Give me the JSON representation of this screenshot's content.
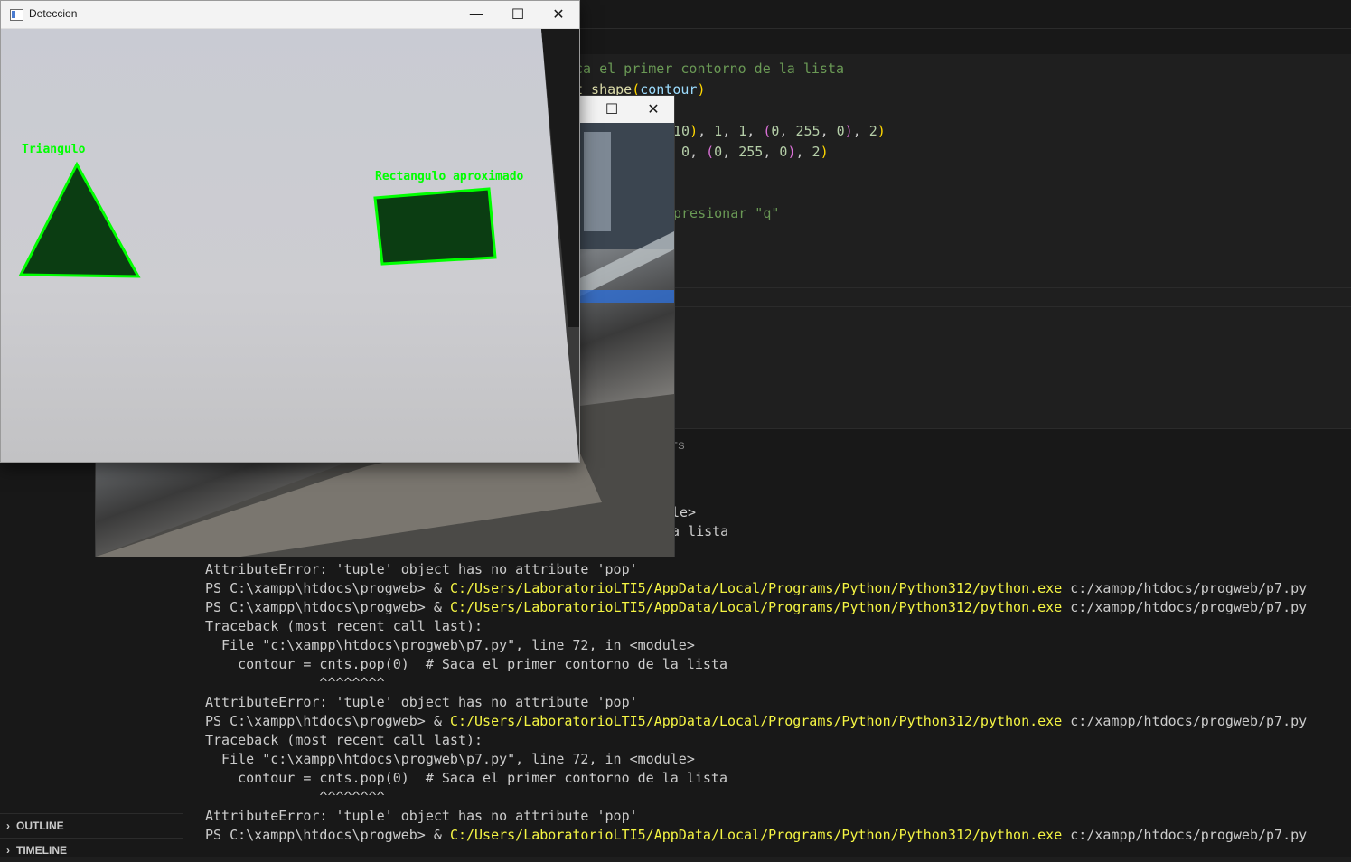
{
  "editor": {
    "lines": [
      {
        "segments": [
          [
            "cm",
            "ca el primer contorno de la lista"
          ]
        ]
      },
      {
        "segments": [
          [
            "fn",
            "t shape"
          ],
          [
            "p1",
            "("
          ],
          [
            "var",
            "contour"
          ],
          [
            "p1",
            ")"
          ]
        ]
      },
      {
        "segments": []
      },
      {
        "segments": [
          [
            "num",
            "10"
          ],
          [
            "p1",
            ")"
          ],
          [
            "",
            ","
          ],
          [
            "num",
            " 1"
          ],
          [
            "",
            ", "
          ],
          [
            "num",
            "1"
          ],
          [
            "",
            ", "
          ],
          [
            "p2",
            "("
          ],
          [
            "num",
            "0"
          ],
          [
            "",
            ", "
          ],
          [
            "num",
            "255"
          ],
          [
            "",
            ", "
          ],
          [
            "num",
            "0"
          ],
          [
            "p2",
            ")"
          ],
          [
            "",
            ", "
          ],
          [
            "num",
            "2"
          ],
          [
            "p1",
            ")"
          ]
        ]
      },
      {
        "segments": [
          [
            "num",
            " 0"
          ],
          [
            "",
            ", "
          ],
          [
            "p2",
            "("
          ],
          [
            "num",
            "0"
          ],
          [
            "",
            ", "
          ],
          [
            "num",
            "255"
          ],
          [
            "",
            ", "
          ],
          [
            "num",
            "0"
          ],
          [
            "p2",
            ")"
          ],
          [
            "",
            ", "
          ],
          [
            "num",
            "2"
          ],
          [
            "p1",
            ")"
          ]
        ]
      },
      {
        "segments": []
      },
      {
        "segments": []
      },
      {
        "segments": [
          [
            "cm",
            "presionar \"q\""
          ]
        ]
      }
    ],
    "raw": [
      "ca el primer contorno de la lista",
      "t shape(contour)",
      "",
      "10), 1, 1, (0, 255, 0), 2)",
      " 0, (0, 255, 0), 2)",
      "",
      "",
      "presionar \"q\""
    ]
  },
  "terminal": {
    "panel_tab": "TS",
    "partial_lines": [
      "le>",
      "a lista"
    ],
    "lines": [
      {
        "pre": "AttributeError: 'tuple' object has no attribute 'pop'",
        "path": "",
        "post": ""
      },
      {
        "pre": "PS C:\\xampp\\htdocs\\progweb> & ",
        "path": "C:/Users/LaboratorioLTI5/AppData/Local/Programs/Python/Python312/python.exe",
        "post": " c:/xampp/htdocs/progweb/p7.py"
      },
      {
        "pre": "PS C:\\xampp\\htdocs\\progweb> & ",
        "path": "C:/Users/LaboratorioLTI5/AppData/Local/Programs/Python/Python312/python.exe",
        "post": " c:/xampp/htdocs/progweb/p7.py"
      },
      {
        "pre": "Traceback (most recent call last):",
        "path": "",
        "post": ""
      },
      {
        "pre": "  File \"c:\\xampp\\htdocs\\progweb\\p7.py\", line 72, in <module>",
        "path": "",
        "post": ""
      },
      {
        "pre": "    contour = cnts.pop(0)  # Saca el primer contorno de la lista",
        "path": "",
        "post": ""
      },
      {
        "pre": "              ^^^^^^^^",
        "path": "",
        "post": ""
      },
      {
        "pre": "AttributeError: 'tuple' object has no attribute 'pop'",
        "path": "",
        "post": ""
      },
      {
        "pre": "PS C:\\xampp\\htdocs\\progweb> & ",
        "path": "C:/Users/LaboratorioLTI5/AppData/Local/Programs/Python/Python312/python.exe",
        "post": " c:/xampp/htdocs/progweb/p7.py"
      },
      {
        "pre": "Traceback (most recent call last):",
        "path": "",
        "post": ""
      },
      {
        "pre": "  File \"c:\\xampp\\htdocs\\progweb\\p7.py\", line 72, in <module>",
        "path": "",
        "post": ""
      },
      {
        "pre": "    contour = cnts.pop(0)  # Saca el primer contorno de la lista",
        "path": "",
        "post": ""
      },
      {
        "pre": "              ^^^^^^^^",
        "path": "",
        "post": ""
      },
      {
        "pre": "AttributeError: 'tuple' object has no attribute 'pop'",
        "path": "",
        "post": ""
      },
      {
        "pre": "PS C:\\xampp\\htdocs\\progweb> & ",
        "path": "C:/Users/LaboratorioLTI5/AppData/Local/Programs/Python/Python312/python.exe",
        "post": " c:/xampp/htdocs/progweb/p7.py"
      }
    ]
  },
  "sidebar": {
    "outline_label": "OUTLINE",
    "timeline_label": "TIMELINE"
  },
  "window_front": {
    "title": "Deteccion",
    "minimize_glyph": "—",
    "maximize_glyph": "☐",
    "close_glyph": "✕",
    "shapes": [
      {
        "label": "Triangulo"
      },
      {
        "label": "Rectangulo aproximado"
      }
    ],
    "outline_color": "#00ff00",
    "fill_color": "#0b3d12"
  },
  "window_back": {
    "maximize_glyph": "☐",
    "close_glyph": "✕"
  }
}
